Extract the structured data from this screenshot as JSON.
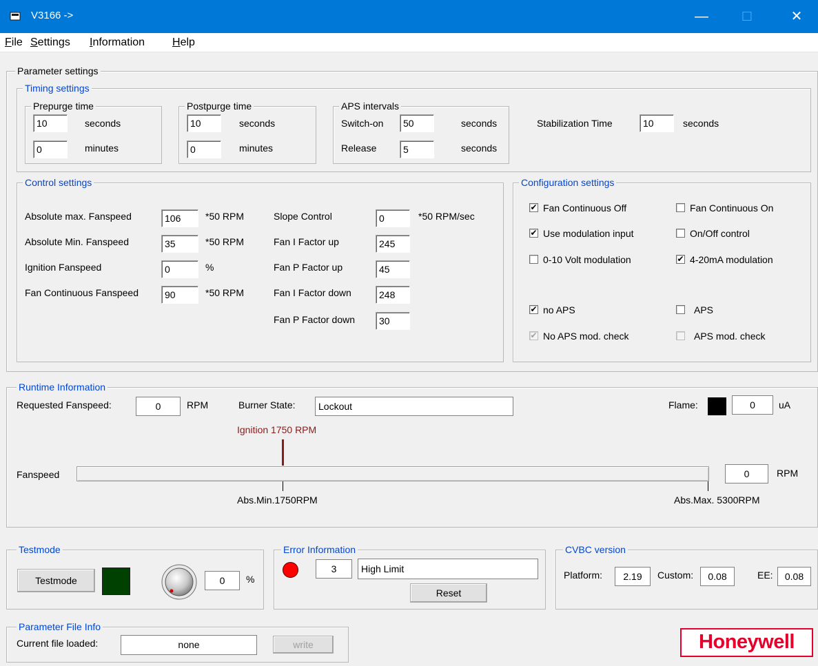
{
  "window": {
    "title": "V3166  ->",
    "minimize_glyph": "—",
    "maximize_glyph": "☐",
    "close_glyph": "✕"
  },
  "menu": [
    {
      "underline": "F",
      "rest": "ile"
    },
    {
      "underline": "S",
      "rest": "ettings"
    },
    {
      "underline": "I",
      "rest": "nformation"
    },
    {
      "underline": "H",
      "rest": "elp"
    }
  ],
  "parameter_settings": {
    "title": "Parameter settings",
    "timing": {
      "title": "Timing settings",
      "prepurge": {
        "title": "Prepurge time",
        "seconds_value": "10",
        "seconds_unit": "seconds",
        "minutes_value": "0",
        "minutes_unit": "minutes"
      },
      "postpurge": {
        "title": "Postpurge time",
        "seconds_value": "10",
        "seconds_unit": "seconds",
        "minutes_value": "0",
        "minutes_unit": "minutes"
      },
      "aps": {
        "title": "APS intervals",
        "switch_on_label": "Switch-on",
        "switch_on_value": "50",
        "switch_on_unit": "seconds",
        "release_label": "Release",
        "release_value": "5",
        "release_unit": "seconds"
      },
      "stabilization": {
        "label": "Stabilization Time",
        "value": "10",
        "unit": "seconds"
      }
    },
    "control": {
      "title": "Control settings",
      "abs_max": {
        "label": "Absolute max. Fanspeed",
        "value": "106",
        "unit": "*50 RPM"
      },
      "abs_min": {
        "label": "Absolute Min. Fanspeed",
        "value": "35",
        "unit": "*50 RPM"
      },
      "ignition": {
        "label": "Ignition Fanspeed",
        "value": "0",
        "unit": "%"
      },
      "fan_cont": {
        "label": "Fan Continuous Fanspeed",
        "value": "90",
        "unit": "*50 RPM"
      },
      "slope": {
        "label": "Slope Control",
        "value": "0",
        "unit": "*50 RPM/sec"
      },
      "fan_i_up": {
        "label": "Fan I Factor up",
        "value": "245"
      },
      "fan_p_up": {
        "label": "Fan P Factor up",
        "value": "45"
      },
      "fan_i_down": {
        "label": "Fan I Factor down",
        "value": "248"
      },
      "fan_p_down": {
        "label": "Fan P Factor down",
        "value": "30"
      }
    },
    "configuration": {
      "title": "Configuration settings",
      "fan_cont_off": {
        "label": "Fan Continuous Off",
        "checked": true
      },
      "fan_cont_on": {
        "label": "Fan Continuous On",
        "checked": false
      },
      "use_mod": {
        "label": "Use modulation input",
        "checked": true
      },
      "onoff": {
        "label": "On/Off control",
        "checked": false
      },
      "volt": {
        "label": "0-10 Volt modulation",
        "checked": false
      },
      "ma": {
        "label": "4-20mA modulation",
        "checked": true
      },
      "no_aps": {
        "label": "no APS",
        "checked": true
      },
      "aps": {
        "label": "APS",
        "checked": false
      },
      "no_aps_mod": {
        "label": "No APS mod. check",
        "checked": true,
        "disabled": true
      },
      "aps_mod": {
        "label": "APS mod. check",
        "checked": false,
        "disabled": true
      },
      "check_glyph": "✔"
    }
  },
  "runtime": {
    "title": "Runtime Information",
    "requested_label": "Requested Fanspeed:",
    "requested_value": "0",
    "requested_unit": "RPM",
    "burner_label": "Burner State:",
    "burner_value": "Lockout",
    "flame_label": "Flame:",
    "flame_value": "0",
    "flame_unit": "uA",
    "ignition_marker": "Ignition  1750 RPM",
    "fanspeed_label": "Fanspeed",
    "fanspeed_value": "0",
    "fanspeed_unit": "RPM",
    "abs_min_label": "Abs.Min.1750RPM",
    "abs_max_label": "Abs.Max. 5300RPM"
  },
  "testmode": {
    "title": "Testmode",
    "button_label": "Testmode",
    "value": "0",
    "unit": "%",
    "indicator_color": "#004000"
  },
  "error": {
    "title": "Error Information",
    "code": "3",
    "message": "High Limit",
    "reset_label": "Reset",
    "led_color": "#ff0000"
  },
  "cvbc": {
    "title": "CVBC version",
    "platform_label": "Platform:",
    "platform_value": "2.19",
    "custom_label": "Custom:",
    "custom_value": "0.08",
    "ee_label": "EE:",
    "ee_value": "0.08"
  },
  "param_file": {
    "title": "Parameter File Info",
    "current_label": "Current file loaded:",
    "current_value": "none",
    "write_label": "write"
  },
  "brand": {
    "logo_text": "Honeywell",
    "color": "#e4002b"
  }
}
